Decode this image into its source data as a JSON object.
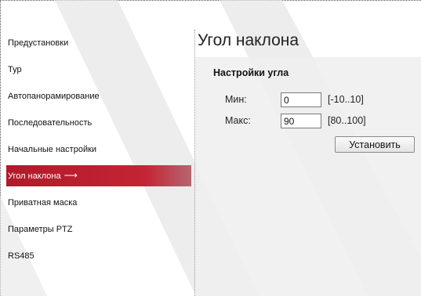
{
  "sidebar": {
    "items": [
      {
        "label": "Предустановки"
      },
      {
        "label": "Тур"
      },
      {
        "label": "Автопанорамирование"
      },
      {
        "label": "Последовательность"
      },
      {
        "label": "Начальные настройки"
      },
      {
        "label": "Угол наклона",
        "active": true,
        "arrow": "⟶"
      },
      {
        "label": "Приватная маска"
      },
      {
        "label": "Параметры PTZ"
      },
      {
        "label": "RS485"
      }
    ]
  },
  "main": {
    "title": "Угол наклона",
    "section_title": "Настройки угла",
    "min": {
      "label": "Мин:",
      "value": "0",
      "range": "[-10..10]"
    },
    "max": {
      "label": "Макс:",
      "value": "90",
      "range": "[80..100]"
    },
    "set_button": "Установить"
  },
  "colors": {
    "active_item": "#c42434",
    "panel_background": "#eeeeee",
    "watermark": "#dedede"
  }
}
